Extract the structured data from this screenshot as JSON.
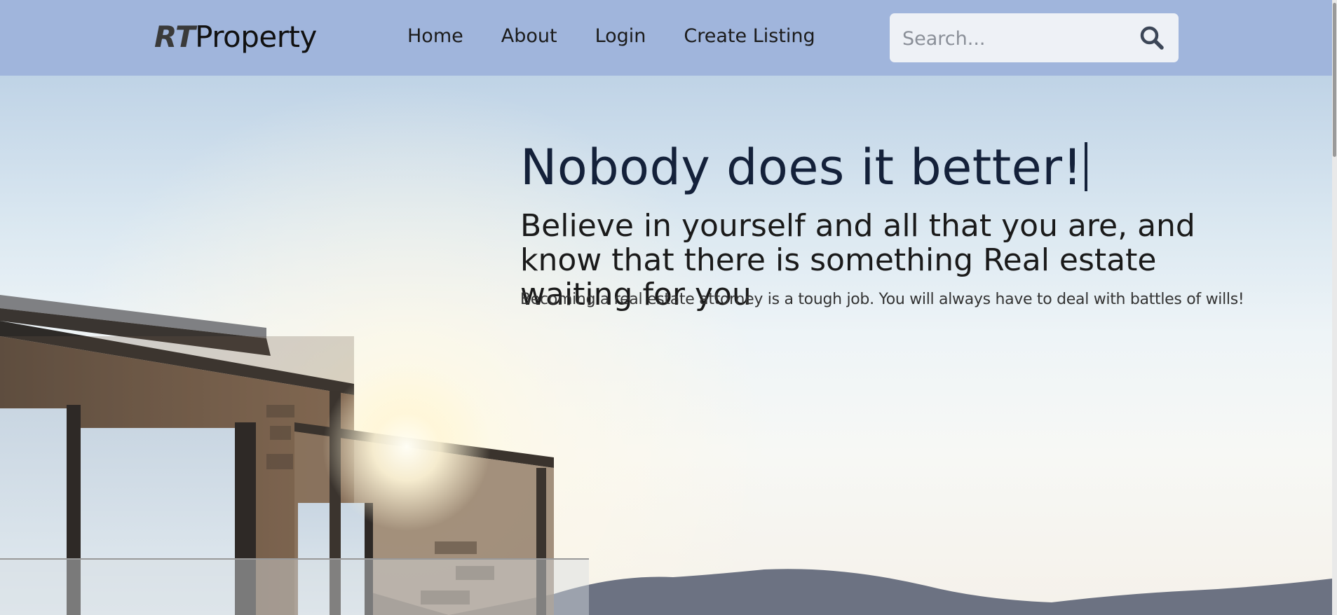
{
  "header": {
    "logo_rt": "RT",
    "logo_property": "Property",
    "nav": [
      {
        "label": "Home"
      },
      {
        "label": "About"
      },
      {
        "label": "Login"
      },
      {
        "label": "Create Listing"
      }
    ],
    "search": {
      "placeholder": "Search...",
      "icon": "search-icon"
    }
  },
  "hero": {
    "headline": "Nobody does it better!",
    "subheadline": "Believe in yourself and all that you are, and know that there is something Real estate waiting for you",
    "tagline": "Becoming a real estate attorney is a tough job. You will always have to deal with battles of wills!"
  },
  "colors": {
    "header_bg": "#a0b5dc",
    "headline_color": "#14213a",
    "search_bg": "#eef1f6"
  }
}
